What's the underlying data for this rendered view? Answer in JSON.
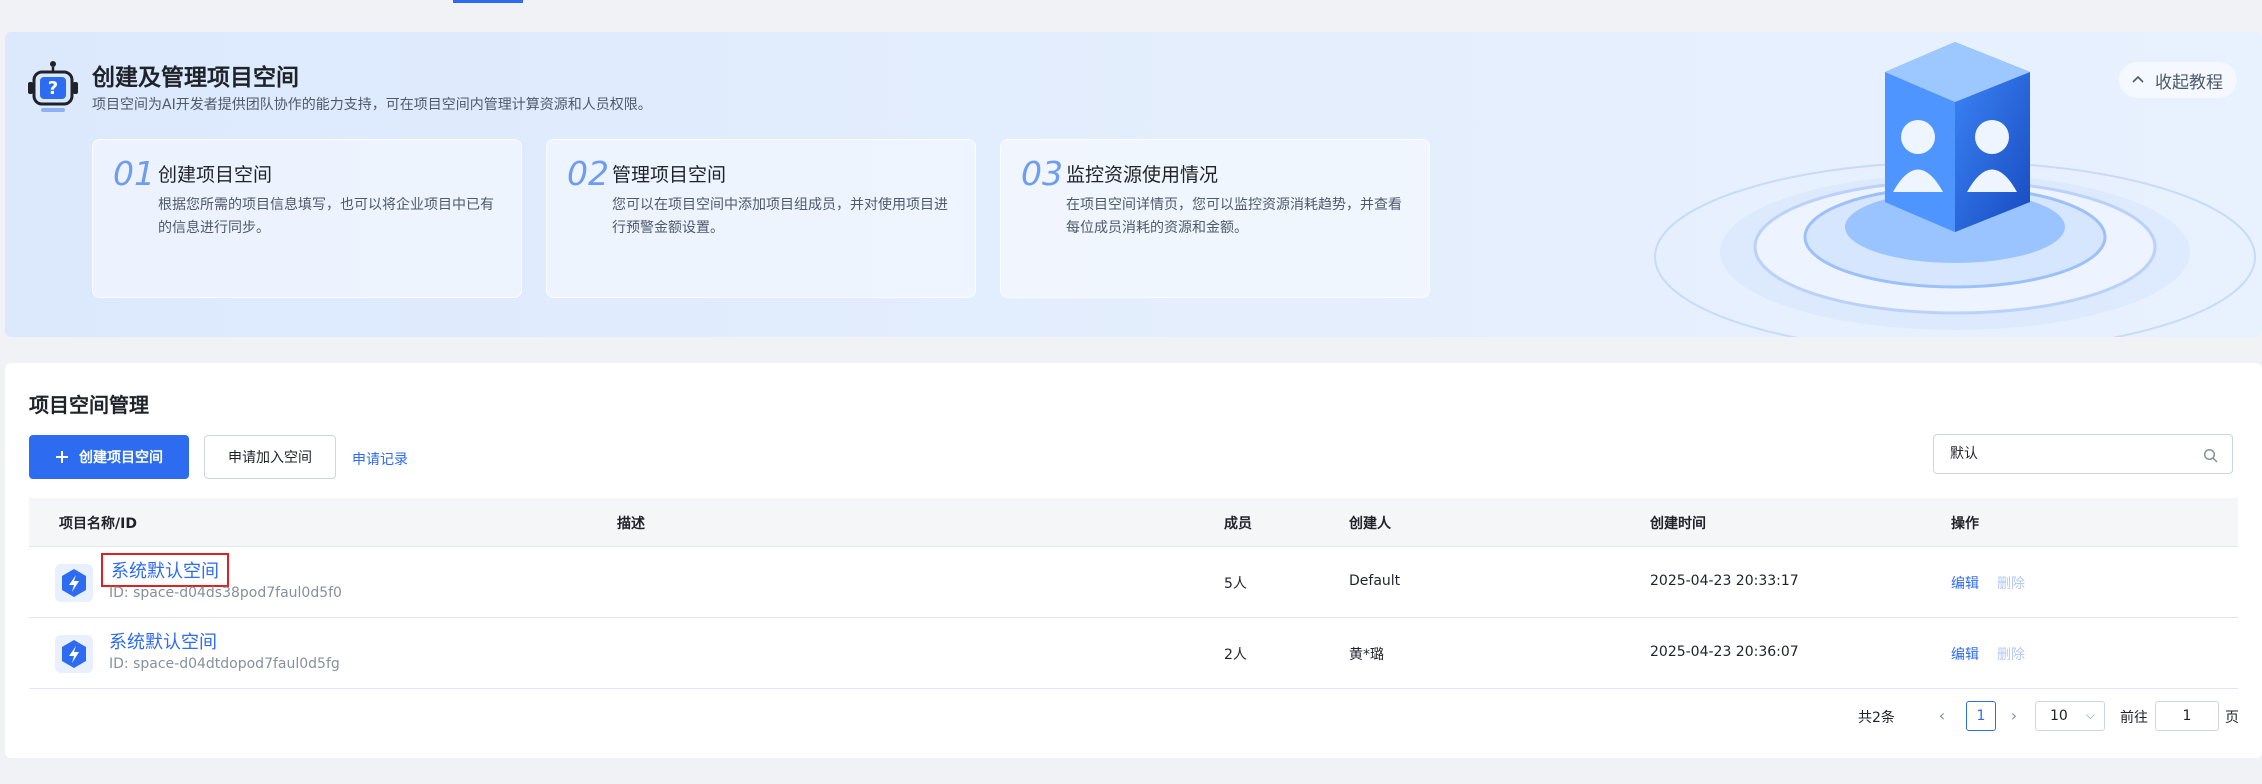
{
  "banner": {
    "title": "创建及管理项目空间",
    "subtitle": "项目空间为AI开发者提供团队协作的能力支持，可在项目空间内管理计算资源和人员权限。",
    "collapse_label": "收起教程",
    "steps": [
      {
        "num": "01",
        "title": "创建项目空间",
        "desc": "根据您所需的项目信息填写，也可以将企业项目中已有的信息进行同步。"
      },
      {
        "num": "02",
        "title": "管理项目空间",
        "desc": "您可以在项目空间中添加项目组成员，并对使用项目进行预警金额设置。"
      },
      {
        "num": "03",
        "title": "监控资源使用情况",
        "desc": "在项目空间详情页，您可以监控资源消耗趋势，并查看每位成员消耗的资源和金额。"
      }
    ]
  },
  "panel": {
    "title": "项目空间管理",
    "create_label": "创建项目空间",
    "join_label": "申请加入空间",
    "record_label": "申请记录",
    "search_value": "默认"
  },
  "table": {
    "headers": {
      "name": "项目名称/ID",
      "desc": "描述",
      "members": "成员",
      "creator": "创建人",
      "created": "创建时间",
      "ops": "操作"
    },
    "rows": [
      {
        "name": "系统默认空间",
        "id": "ID: space-d04ds38pod7faul0d5f0",
        "desc": "",
        "members": "5人",
        "creator": "Default",
        "created": "2025-04-23 20:33:17",
        "edit": "编辑",
        "delete": "删除"
      },
      {
        "name": "系统默认空间",
        "id": "ID: space-d04dtdopod7faul0d5fg",
        "desc": "",
        "members": "2人",
        "creator": "黄*璐",
        "created": "2025-04-23 20:36:07",
        "edit": "编辑",
        "delete": "删除"
      }
    ]
  },
  "pagination": {
    "total": "共2条",
    "current": "1",
    "page_size": "10",
    "goto_label": "前往",
    "goto_value": "1",
    "page_suffix": "页"
  },
  "colors": {
    "primary": "#2d6bf0",
    "highlight_border": "#e02020"
  }
}
